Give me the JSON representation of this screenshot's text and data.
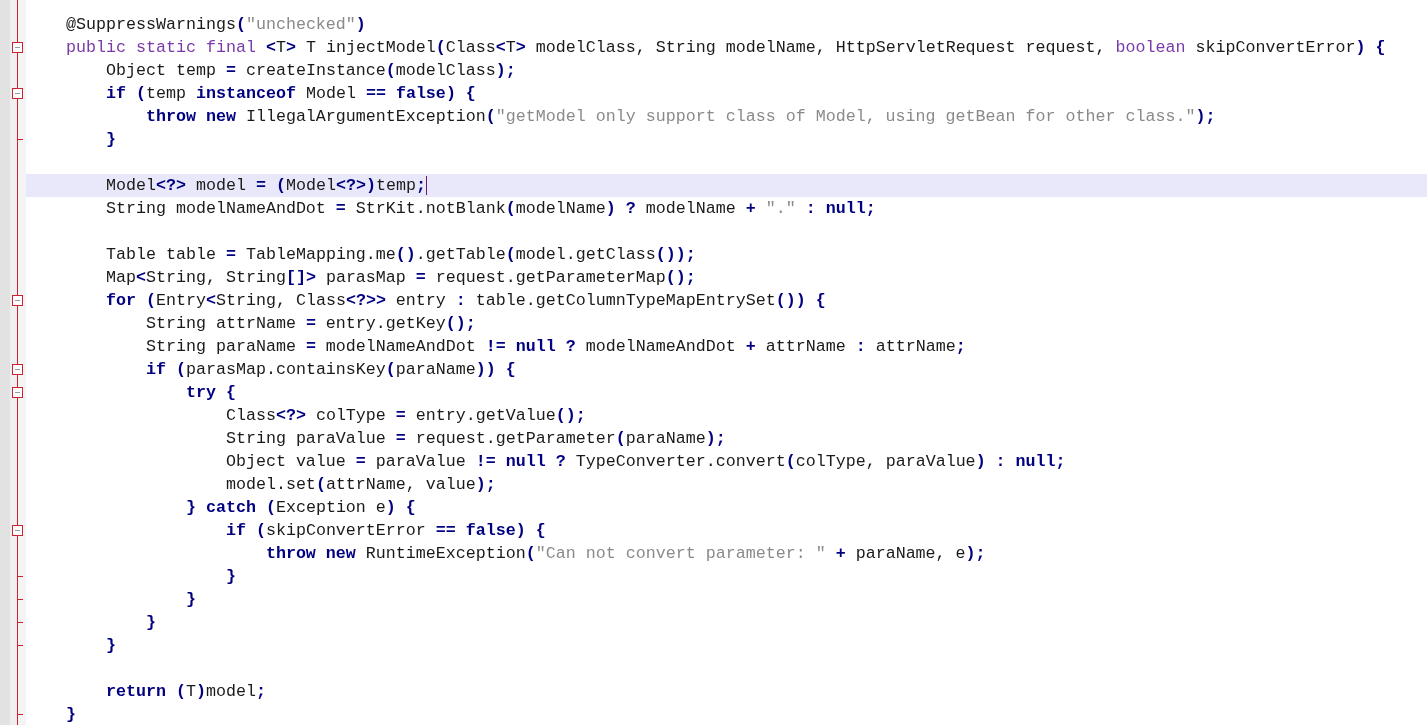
{
  "editor": {
    "lines": [
      {
        "tokens": [
          {
            "text": "    @SuppressWarnings",
            "kind": "plain"
          },
          {
            "text": "(",
            "kind": "symbol"
          },
          {
            "text": "\"unchecked\"",
            "kind": "string"
          },
          {
            "text": ")",
            "kind": "symbol"
          }
        ]
      },
      {
        "fold_start": true,
        "tokens": [
          {
            "text": "    public static final",
            "kind": "modifier"
          },
          {
            "text": " <",
            "kind": "symbol"
          },
          {
            "text": "T",
            "kind": "plain"
          },
          {
            "text": ">",
            "kind": "symbol"
          },
          {
            "text": " T injectModel",
            "kind": "plain"
          },
          {
            "text": "(",
            "kind": "symbol"
          },
          {
            "text": "Class",
            "kind": "plain"
          },
          {
            "text": "<",
            "kind": "symbol"
          },
          {
            "text": "T",
            "kind": "plain"
          },
          {
            "text": ">",
            "kind": "symbol"
          },
          {
            "text": " modelClass, String modelName, HttpServletRequest request, ",
            "kind": "plain"
          },
          {
            "text": "boolean",
            "kind": "modifier"
          },
          {
            "text": " skipConvertError",
            "kind": "plain"
          },
          {
            "text": ") {",
            "kind": "symbol"
          }
        ]
      },
      {
        "tokens": [
          {
            "text": "        Object temp ",
            "kind": "plain"
          },
          {
            "text": "=",
            "kind": "symbol"
          },
          {
            "text": " createInstance",
            "kind": "plain"
          },
          {
            "text": "(",
            "kind": "symbol"
          },
          {
            "text": "modelClass",
            "kind": "plain"
          },
          {
            "text": ");",
            "kind": "symbol"
          }
        ]
      },
      {
        "fold_start": true,
        "tokens": [
          {
            "text": "        if",
            "kind": "keyword"
          },
          {
            "text": " (",
            "kind": "symbol"
          },
          {
            "text": "temp ",
            "kind": "plain"
          },
          {
            "text": "instanceof",
            "kind": "keyword"
          },
          {
            "text": " Model ",
            "kind": "plain"
          },
          {
            "text": "==",
            "kind": "symbol"
          },
          {
            "text": " false",
            "kind": "keyword"
          },
          {
            "text": ") {",
            "kind": "symbol"
          }
        ]
      },
      {
        "tokens": [
          {
            "text": "            throw new",
            "kind": "keyword"
          },
          {
            "text": " IllegalArgumentException",
            "kind": "plain"
          },
          {
            "text": "(",
            "kind": "symbol"
          },
          {
            "text": "\"getModel only support class of Model, using getBean for other class.\"",
            "kind": "string"
          },
          {
            "text": ");",
            "kind": "symbol"
          }
        ]
      },
      {
        "fold_end": true,
        "tokens": [
          {
            "text": "        }",
            "kind": "symbol"
          }
        ]
      },
      {
        "gap_before": true,
        "current": true,
        "tokens": [
          {
            "text": "        Model",
            "kind": "plain"
          },
          {
            "text": "<?>",
            "kind": "symbol"
          },
          {
            "text": " model ",
            "kind": "plain"
          },
          {
            "text": "= (",
            "kind": "symbol"
          },
          {
            "text": "Model",
            "kind": "plain"
          },
          {
            "text": "<?>)",
            "kind": "symbol"
          },
          {
            "text": "temp",
            "kind": "plain"
          },
          {
            "text": ";",
            "kind": "symbol"
          }
        ]
      },
      {
        "tokens": [
          {
            "text": "        String modelNameAndDot ",
            "kind": "plain"
          },
          {
            "text": "=",
            "kind": "symbol"
          },
          {
            "text": " StrKit.notBlank",
            "kind": "plain"
          },
          {
            "text": "(",
            "kind": "symbol"
          },
          {
            "text": "modelName",
            "kind": "plain"
          },
          {
            "text": ") ?",
            "kind": "symbol"
          },
          {
            "text": " modelName ",
            "kind": "plain"
          },
          {
            "text": "+",
            "kind": "symbol"
          },
          {
            "text": " \".\" ",
            "kind": "string"
          },
          {
            "text": ":",
            "kind": "symbol"
          },
          {
            "text": " null",
            "kind": "keyword"
          },
          {
            "text": ";",
            "kind": "symbol"
          }
        ]
      },
      {
        "gap_before": true,
        "tokens": [
          {
            "text": "        Table table ",
            "kind": "plain"
          },
          {
            "text": "=",
            "kind": "symbol"
          },
          {
            "text": " TableMapping.me",
            "kind": "plain"
          },
          {
            "text": "()",
            "kind": "symbol"
          },
          {
            "text": ".getTable",
            "kind": "plain"
          },
          {
            "text": "(",
            "kind": "symbol"
          },
          {
            "text": "model.getClass",
            "kind": "plain"
          },
          {
            "text": "());",
            "kind": "symbol"
          }
        ]
      },
      {
        "tokens": [
          {
            "text": "        Map",
            "kind": "plain"
          },
          {
            "text": "<",
            "kind": "symbol"
          },
          {
            "text": "String, String",
            "kind": "plain"
          },
          {
            "text": "[]>",
            "kind": "symbol"
          },
          {
            "text": " parasMap ",
            "kind": "plain"
          },
          {
            "text": "=",
            "kind": "symbol"
          },
          {
            "text": " request.getParameterMap",
            "kind": "plain"
          },
          {
            "text": "();",
            "kind": "symbol"
          }
        ]
      },
      {
        "fold_start": true,
        "tokens": [
          {
            "text": "        for",
            "kind": "keyword"
          },
          {
            "text": " (",
            "kind": "symbol"
          },
          {
            "text": "Entry",
            "kind": "plain"
          },
          {
            "text": "<",
            "kind": "symbol"
          },
          {
            "text": "String, Class",
            "kind": "plain"
          },
          {
            "text": "<?>>",
            "kind": "symbol"
          },
          {
            "text": " entry ",
            "kind": "plain"
          },
          {
            "text": ":",
            "kind": "symbol"
          },
          {
            "text": " table.getColumnTypeMapEntrySet",
            "kind": "plain"
          },
          {
            "text": "()) {",
            "kind": "symbol"
          }
        ]
      },
      {
        "tokens": [
          {
            "text": "            String attrName ",
            "kind": "plain"
          },
          {
            "text": "=",
            "kind": "symbol"
          },
          {
            "text": " entry.getKey",
            "kind": "plain"
          },
          {
            "text": "();",
            "kind": "symbol"
          }
        ]
      },
      {
        "tokens": [
          {
            "text": "            String paraName ",
            "kind": "plain"
          },
          {
            "text": "=",
            "kind": "symbol"
          },
          {
            "text": " modelNameAndDot ",
            "kind": "plain"
          },
          {
            "text": "!=",
            "kind": "symbol"
          },
          {
            "text": " null",
            "kind": "keyword"
          },
          {
            "text": " ?",
            "kind": "symbol"
          },
          {
            "text": " modelNameAndDot ",
            "kind": "plain"
          },
          {
            "text": "+",
            "kind": "symbol"
          },
          {
            "text": " attrName ",
            "kind": "plain"
          },
          {
            "text": ":",
            "kind": "symbol"
          },
          {
            "text": " attrName",
            "kind": "plain"
          },
          {
            "text": ";",
            "kind": "symbol"
          }
        ]
      },
      {
        "fold_start": true,
        "tokens": [
          {
            "text": "            if",
            "kind": "keyword"
          },
          {
            "text": " (",
            "kind": "symbol"
          },
          {
            "text": "parasMap.containsKey",
            "kind": "plain"
          },
          {
            "text": "(",
            "kind": "symbol"
          },
          {
            "text": "paraName",
            "kind": "plain"
          },
          {
            "text": ")) {",
            "kind": "symbol"
          }
        ]
      },
      {
        "fold_start": true,
        "tokens": [
          {
            "text": "                try",
            "kind": "keyword"
          },
          {
            "text": " {",
            "kind": "symbol"
          }
        ]
      },
      {
        "tokens": [
          {
            "text": "                    Class",
            "kind": "plain"
          },
          {
            "text": "<?>",
            "kind": "symbol"
          },
          {
            "text": " colType ",
            "kind": "plain"
          },
          {
            "text": "=",
            "kind": "symbol"
          },
          {
            "text": " entry.getValue",
            "kind": "plain"
          },
          {
            "text": "();",
            "kind": "symbol"
          }
        ]
      },
      {
        "tokens": [
          {
            "text": "                    String paraValue ",
            "kind": "plain"
          },
          {
            "text": "=",
            "kind": "symbol"
          },
          {
            "text": " request.getParameter",
            "kind": "plain"
          },
          {
            "text": "(",
            "kind": "symbol"
          },
          {
            "text": "paraName",
            "kind": "plain"
          },
          {
            "text": ");",
            "kind": "symbol"
          }
        ]
      },
      {
        "tokens": [
          {
            "text": "                    Object value ",
            "kind": "plain"
          },
          {
            "text": "=",
            "kind": "symbol"
          },
          {
            "text": " paraValue ",
            "kind": "plain"
          },
          {
            "text": "!=",
            "kind": "symbol"
          },
          {
            "text": " null",
            "kind": "keyword"
          },
          {
            "text": " ?",
            "kind": "symbol"
          },
          {
            "text": " TypeConverter.convert",
            "kind": "plain"
          },
          {
            "text": "(",
            "kind": "symbol"
          },
          {
            "text": "colType, paraValue",
            "kind": "plain"
          },
          {
            "text": ") :",
            "kind": "symbol"
          },
          {
            "text": " null",
            "kind": "keyword"
          },
          {
            "text": ";",
            "kind": "symbol"
          }
        ]
      },
      {
        "tokens": [
          {
            "text": "                    model.set",
            "kind": "plain"
          },
          {
            "text": "(",
            "kind": "symbol"
          },
          {
            "text": "attrName, value",
            "kind": "plain"
          },
          {
            "text": ");",
            "kind": "symbol"
          }
        ]
      },
      {
        "tokens": [
          {
            "text": "                }",
            "kind": "symbol"
          },
          {
            "text": " catch",
            "kind": "keyword"
          },
          {
            "text": " (",
            "kind": "symbol"
          },
          {
            "text": "Exception e",
            "kind": "plain"
          },
          {
            "text": ") {",
            "kind": "symbol"
          }
        ]
      },
      {
        "fold_start": true,
        "tokens": [
          {
            "text": "                    if",
            "kind": "keyword"
          },
          {
            "text": " (",
            "kind": "symbol"
          },
          {
            "text": "skipConvertError ",
            "kind": "plain"
          },
          {
            "text": "==",
            "kind": "symbol"
          },
          {
            "text": " false",
            "kind": "keyword"
          },
          {
            "text": ") {",
            "kind": "symbol"
          }
        ]
      },
      {
        "tokens": [
          {
            "text": "                        throw new",
            "kind": "keyword"
          },
          {
            "text": " RuntimeException",
            "kind": "plain"
          },
          {
            "text": "(",
            "kind": "symbol"
          },
          {
            "text": "\"Can not convert parameter: \" ",
            "kind": "string"
          },
          {
            "text": "+",
            "kind": "symbol"
          },
          {
            "text": " paraName, e",
            "kind": "plain"
          },
          {
            "text": ");",
            "kind": "symbol"
          }
        ]
      },
      {
        "fold_end": true,
        "tokens": [
          {
            "text": "                    }",
            "kind": "symbol"
          }
        ]
      },
      {
        "fold_end": true,
        "tokens": [
          {
            "text": "                }",
            "kind": "symbol"
          }
        ]
      },
      {
        "fold_end": true,
        "tokens": [
          {
            "text": "            }",
            "kind": "symbol"
          }
        ]
      },
      {
        "fold_end": true,
        "tokens": [
          {
            "text": "        }",
            "kind": "symbol"
          }
        ]
      },
      {
        "gap_before": true,
        "tokens": [
          {
            "text": "        return",
            "kind": "keyword"
          },
          {
            "text": " (",
            "kind": "symbol"
          },
          {
            "text": "T",
            "kind": "plain"
          },
          {
            "text": ")",
            "kind": "symbol"
          },
          {
            "text": "model",
            "kind": "plain"
          },
          {
            "text": ";",
            "kind": "symbol"
          }
        ]
      },
      {
        "fold_end": true,
        "tokens": [
          {
            "text": "    }",
            "kind": "symbol"
          }
        ]
      }
    ]
  }
}
